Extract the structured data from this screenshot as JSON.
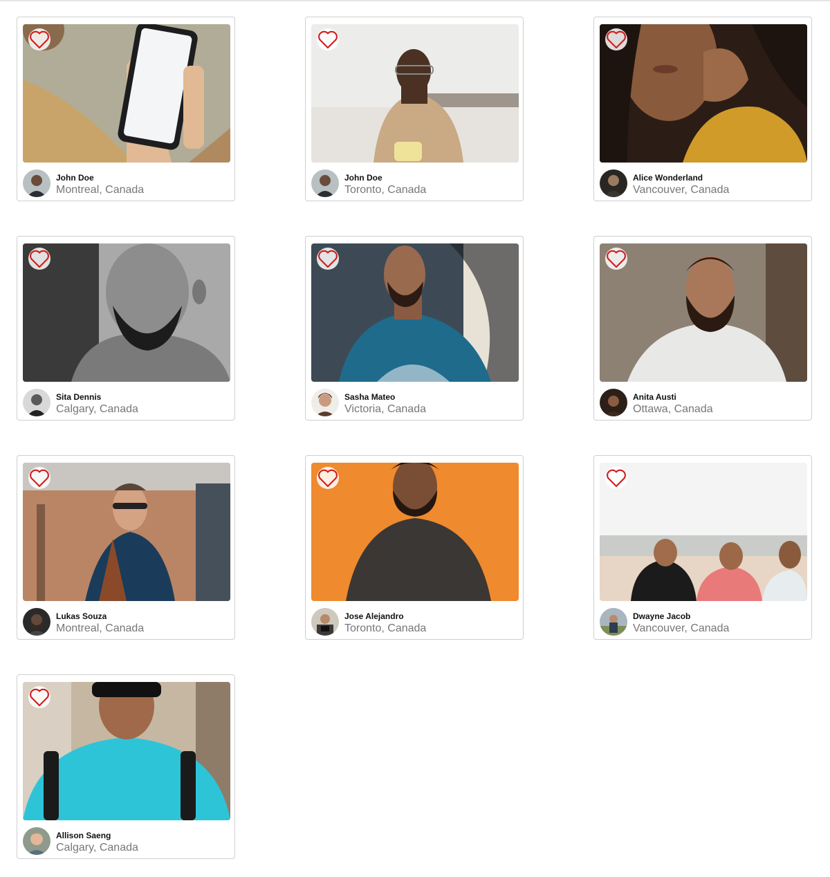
{
  "favorite_icon": "heart-outline-icon",
  "colors": {
    "heart": "#d11d1d",
    "border": "#cfcfcf",
    "name_text": "#111111",
    "location_text": "#777777"
  },
  "cards": [
    {
      "name": "John Doe",
      "location": "Montreal, Canada",
      "photo": "hand-holding-phone",
      "favorited": false
    },
    {
      "name": "John Doe",
      "location": "Toronto, Canada",
      "photo": "man-with-glasses-on-sofa",
      "favorited": false
    },
    {
      "name": "Alice Wonderland",
      "location": "Vancouver, Canada",
      "photo": "woman-curly-hair-yellow-sweater",
      "favorited": false
    },
    {
      "name": "Sita Dennis",
      "location": "Calgary, Canada",
      "photo": "bearded-man-black-and-white",
      "favorited": false
    },
    {
      "name": "Sasha Mateo",
      "location": "Victoria, Canada",
      "photo": "man-blue-tshirt",
      "favorited": false
    },
    {
      "name": "Anita Austi",
      "location": "Ottawa, Canada",
      "photo": "bearded-man-white-shirt",
      "favorited": false
    },
    {
      "name": "Lukas Souza",
      "location": "Montreal, Canada",
      "photo": "man-sunglasses-vest",
      "favorited": false
    },
    {
      "name": "Jose Alejandro",
      "location": "Toronto, Canada",
      "photo": "man-orange-background",
      "favorited": false
    },
    {
      "name": "Dwayne Jacob",
      "location": "Vancouver, Canada",
      "photo": "three-men-on-beach",
      "favorited": false
    },
    {
      "name": "Allison Saeng",
      "location": "Calgary, Canada",
      "photo": "man-cyan-tshirt-backpack",
      "favorited": false
    }
  ]
}
